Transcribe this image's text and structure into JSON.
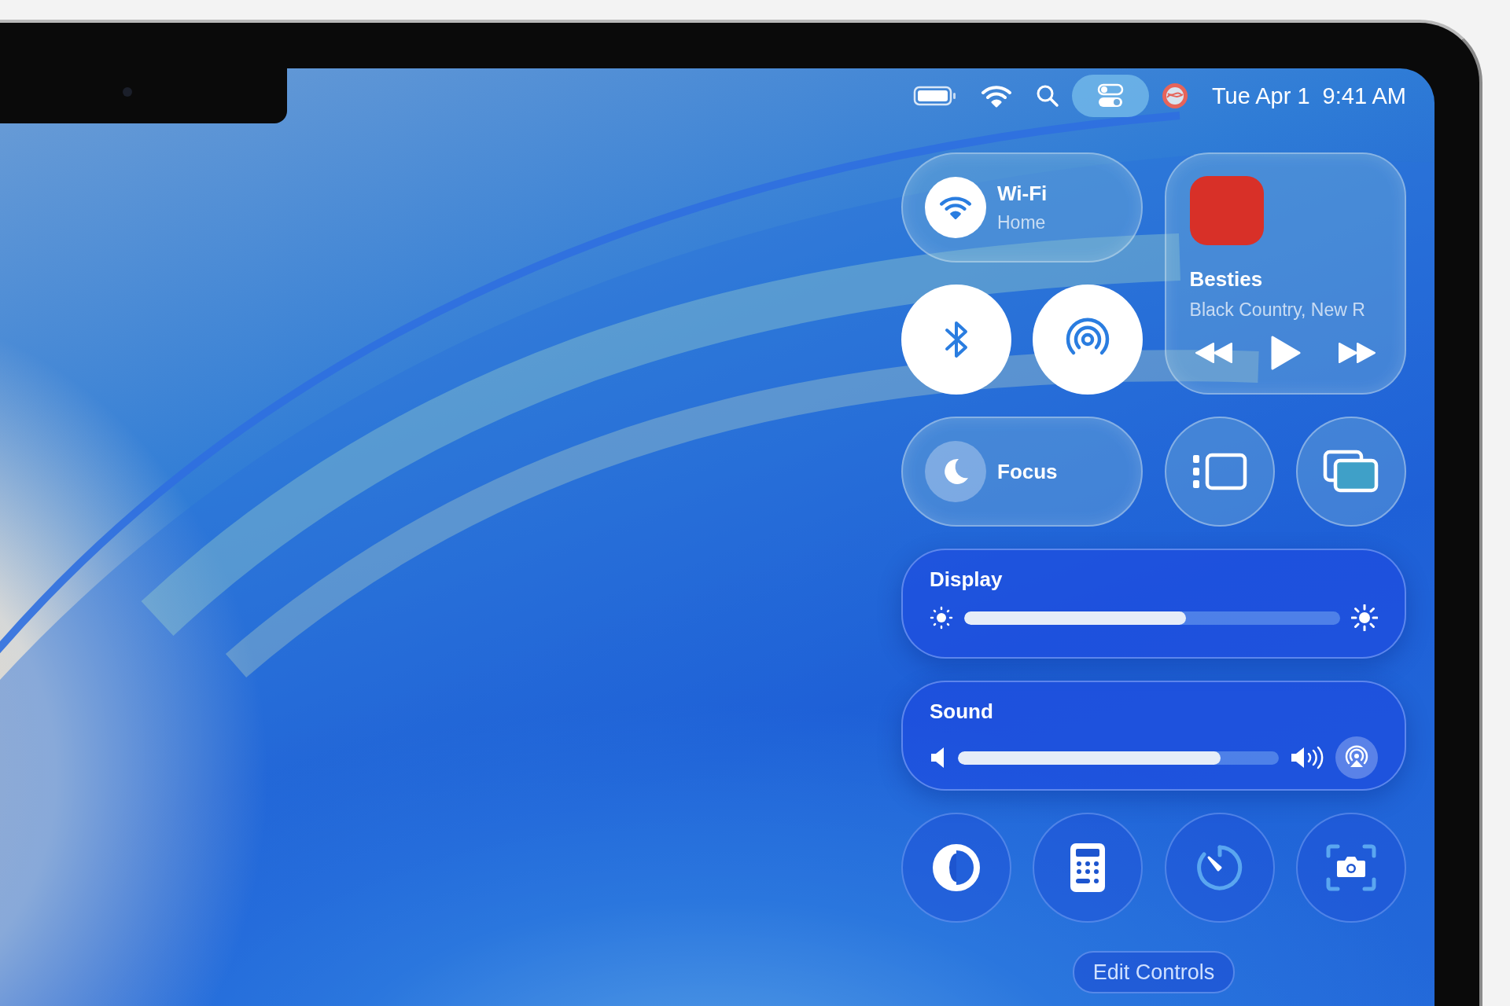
{
  "menu_bar": {
    "control_center_active": true,
    "date": "Tue Apr 1",
    "time": "9:41 AM"
  },
  "control_center": {
    "wifi": {
      "title": "Wi-Fi",
      "subtitle": "Home",
      "on": true
    },
    "bluetooth": {
      "on": true
    },
    "airdrop": {
      "on": true
    },
    "now_playing": {
      "title": "Besties",
      "artist": "Black Country, New R"
    },
    "focus": {
      "label": "Focus",
      "on": false
    },
    "display": {
      "label": "Display",
      "level": 0.59
    },
    "sound": {
      "label": "Sound",
      "level": 0.82
    },
    "edit_button": "Edit Controls"
  }
}
